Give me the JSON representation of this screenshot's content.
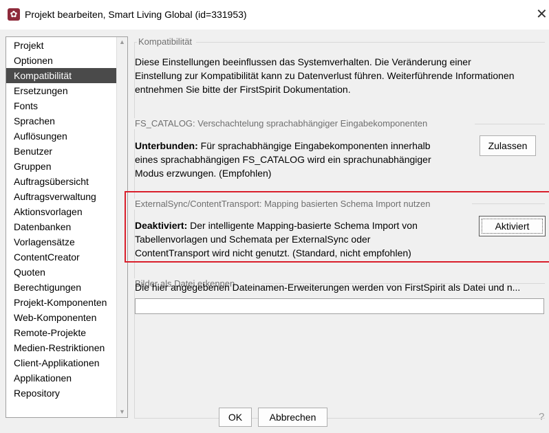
{
  "window": {
    "title": "Projekt bearbeiten, Smart Living Global (id=331953)",
    "app_icon": "gear-icon",
    "close_label": "✕"
  },
  "sidebar": {
    "items": [
      {
        "label": "Projekt",
        "selected": false
      },
      {
        "label": "Optionen",
        "selected": false
      },
      {
        "label": "Kompatibilität",
        "selected": true
      },
      {
        "label": "Ersetzungen",
        "selected": false
      },
      {
        "label": "Fonts",
        "selected": false
      },
      {
        "label": "Sprachen",
        "selected": false
      },
      {
        "label": "Auflösungen",
        "selected": false
      },
      {
        "label": "Benutzer",
        "selected": false
      },
      {
        "label": "Gruppen",
        "selected": false
      },
      {
        "label": "Auftragsübersicht",
        "selected": false
      },
      {
        "label": "Auftragsverwaltung",
        "selected": false
      },
      {
        "label": "Aktionsvorlagen",
        "selected": false
      },
      {
        "label": "Datenbanken",
        "selected": false
      },
      {
        "label": "Vorlagensätze",
        "selected": false
      },
      {
        "label": "ContentCreator",
        "selected": false
      },
      {
        "label": "Quoten",
        "selected": false
      },
      {
        "label": "Berechtigungen",
        "selected": false
      },
      {
        "label": "Projekt-Komponenten",
        "selected": false
      },
      {
        "label": "Web-Komponenten",
        "selected": false
      },
      {
        "label": "Remote-Projekte",
        "selected": false
      },
      {
        "label": "Medien-Restriktionen",
        "selected": false
      },
      {
        "label": "Client-Applikationen",
        "selected": false
      },
      {
        "label": "Applikationen",
        "selected": false
      },
      {
        "label": "Repository",
        "selected": false
      }
    ]
  },
  "main": {
    "legend": "Kompatibilität",
    "intro": [
      "Diese Einstellungen beeinflussen das Systemverhalten. Die Veränderung einer",
      "Einstellung zur Kompatibilität kann zu Datenverlust führen. Weiterführende Informationen",
      "entnehmen Sie bitte der FirstSpirit Dokumentation."
    ],
    "fs_catalog": {
      "legend": "FS_CATALOG: Verschachtelung sprachabhängiger Eingabekomponenten",
      "bold": "Unterbunden:",
      "lines": [
        " Für sprachabhängige Eingabekomponenten innerhalb",
        "eines sprachabhängigen FS_CATALOG wird ein sprachunabhängiger",
        "Modus erzwungen. (Empfohlen)"
      ],
      "button": "Zulassen"
    },
    "external_sync": {
      "legend": "ExternalSync/ContentTransport: Mapping basierten Schema Import nutzen",
      "bold": "Deaktiviert:",
      "lines": [
        " Der intelligente Mapping-basierte Schema Import von",
        "Tabellenvorlagen und Schemata per ExternalSync oder",
        "ContentTransport wird nicht genutzt. (Standard, nicht empfohlen)"
      ],
      "button": "Aktiviert"
    },
    "images": {
      "legend": "Bilder als Datei erkennen",
      "description": "Die hier angegebenen Dateinamen-Erweiterungen werden von FirstSpirit als Datei und n...",
      "input_value": ""
    }
  },
  "footer": {
    "ok": "OK",
    "cancel": "Abbrechen",
    "help": "?"
  },
  "colors": {
    "accent": "#8e2a3b",
    "selection": "#4a4a4a",
    "highlight": "#d91e2a"
  }
}
